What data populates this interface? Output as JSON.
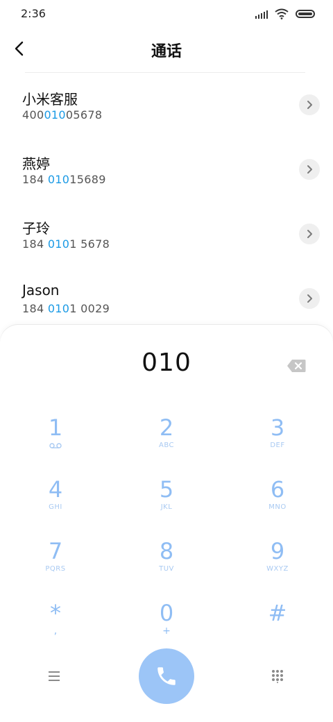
{
  "status_bar": {
    "time": "2:36",
    "icons": [
      "signal-icon",
      "wifi-icon",
      "battery-icon"
    ]
  },
  "header": {
    "back_icon": "chevron-left-icon",
    "title": "通话"
  },
  "search": {
    "query": "010",
    "highlight_color": "#1a9ae5"
  },
  "results": [
    {
      "name": "小米客服",
      "number_parts": [
        "400",
        "010",
        "05678"
      ]
    },
    {
      "name": "燕婷",
      "number_parts": [
        "184 ",
        "010",
        "15689"
      ]
    },
    {
      "name": "子玲",
      "number_parts": [
        "184 ",
        "010",
        "1 5678"
      ]
    },
    {
      "name": "Jason",
      "number_parts": [
        "184 ",
        "010",
        "1 0029"
      ]
    }
  ],
  "dialpad": {
    "input": "010",
    "keys": [
      {
        "digit": "1",
        "letters": "",
        "sub": "voicemail-icon"
      },
      {
        "digit": "2",
        "letters": "ABC"
      },
      {
        "digit": "3",
        "letters": "DEF"
      },
      {
        "digit": "4",
        "letters": "GHI"
      },
      {
        "digit": "5",
        "letters": "JKL"
      },
      {
        "digit": "6",
        "letters": "MNO"
      },
      {
        "digit": "7",
        "letters": "PQRS"
      },
      {
        "digit": "8",
        "letters": "TUV"
      },
      {
        "digit": "9",
        "letters": "WXYZ"
      },
      {
        "digit": "*",
        "letters": "",
        "sub_text": ","
      },
      {
        "digit": "0",
        "letters": "",
        "sub_text": "+"
      },
      {
        "digit": "#",
        "letters": ""
      }
    ],
    "colors": {
      "key": "#8fbdf4",
      "call_button": "#9cc5f7"
    },
    "icons": {
      "menu": "menu-icon",
      "call": "phone-icon",
      "keypad": "dialpad-icon",
      "delete": "backspace-icon"
    }
  }
}
